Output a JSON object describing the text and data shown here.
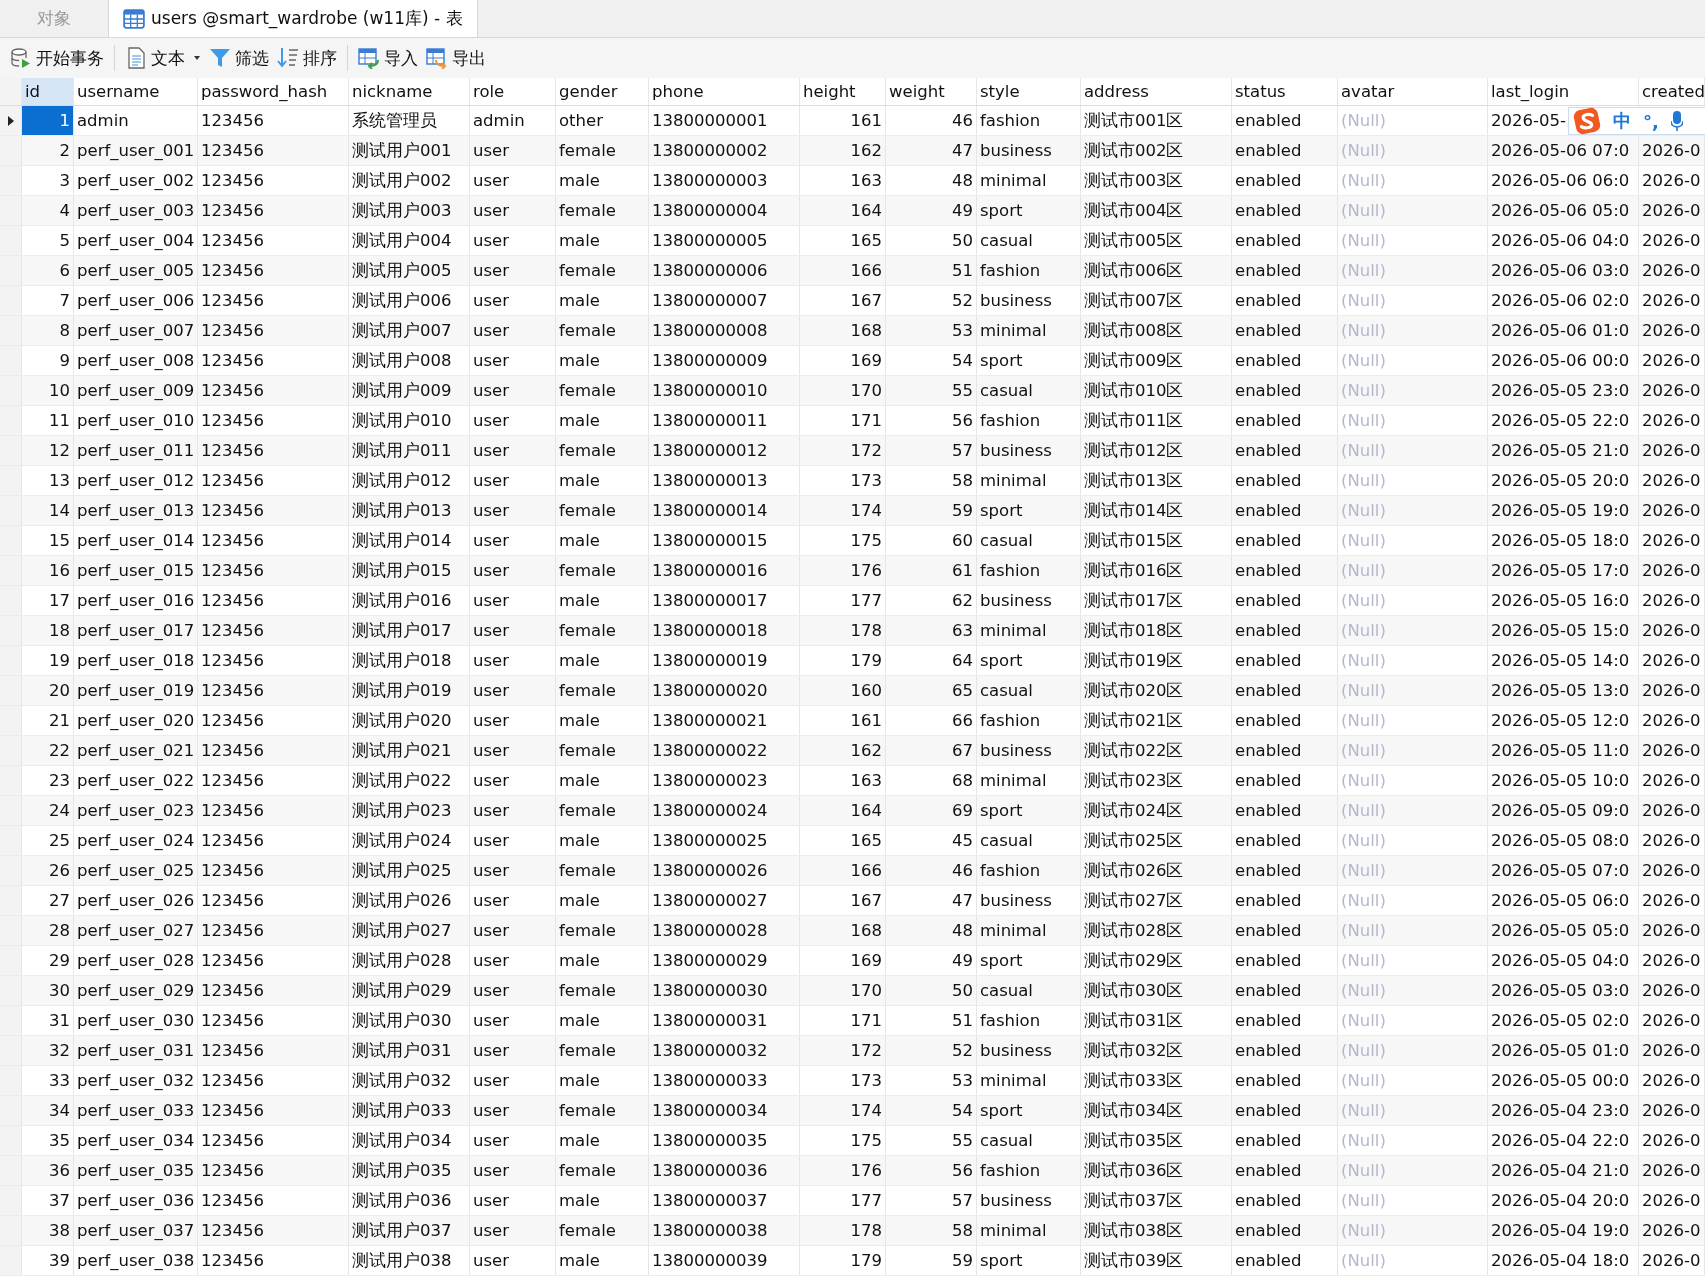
{
  "tabs": [
    {
      "label": "对象",
      "selected": false,
      "icon": false
    },
    {
      "label": "users @smart_wardrobe (w11库) - 表",
      "selected": true,
      "icon": true
    }
  ],
  "toolbar": [
    {
      "label": "开始事务",
      "kind": "transaction",
      "dropdown": false,
      "group_end": true
    },
    {
      "label": "文本",
      "kind": "text",
      "dropdown": true,
      "group_end": false
    },
    {
      "label": "筛选",
      "kind": "filter",
      "dropdown": false,
      "group_end": false
    },
    {
      "label": "排序",
      "kind": "sort",
      "dropdown": false,
      "group_end": true
    },
    {
      "label": "导入",
      "kind": "import",
      "dropdown": false,
      "group_end": false
    },
    {
      "label": "导出",
      "kind": "export",
      "dropdown": false,
      "group_end": false
    }
  ],
  "table": {
    "columns": [
      {
        "name": "id",
        "kind": "number"
      },
      {
        "name": "username",
        "kind": "text"
      },
      {
        "name": "password_hash",
        "kind": "text"
      },
      {
        "name": "nickname",
        "kind": "text"
      },
      {
        "name": "role",
        "kind": "text"
      },
      {
        "name": "gender",
        "kind": "text"
      },
      {
        "name": "phone",
        "kind": "text"
      },
      {
        "name": "height",
        "kind": "number"
      },
      {
        "name": "weight",
        "kind": "number"
      },
      {
        "name": "style",
        "kind": "text"
      },
      {
        "name": "address",
        "kind": "text"
      },
      {
        "name": "status",
        "kind": "text"
      },
      {
        "name": "avatar",
        "kind": "null"
      },
      {
        "name": "last_login",
        "kind": "text"
      },
      {
        "name": "created",
        "kind": "text"
      }
    ],
    "rows": [
      {
        "selected": true,
        "cells": [
          "1",
          "admin",
          "123456",
          "系统管理员",
          "admin",
          "other",
          "13800000001",
          "161",
          "46",
          "fashion",
          "测试市001区",
          "enabled",
          "(Null)",
          "2026-05-"
        ]
      },
      {
        "selected": false,
        "cells": [
          "2",
          "perf_user_001",
          "123456",
          "测试用户001",
          "user",
          "female",
          "13800000002",
          "162",
          "47",
          "business",
          "测试市002区",
          "enabled",
          "(Null)",
          "2026-05-06 07:0",
          "2026-0"
        ]
      },
      {
        "selected": false,
        "cells": [
          "3",
          "perf_user_002",
          "123456",
          "测试用户002",
          "user",
          "male",
          "13800000003",
          "163",
          "48",
          "minimal",
          "测试市003区",
          "enabled",
          "(Null)",
          "2026-05-06 06:0",
          "2026-0"
        ]
      },
      {
        "selected": false,
        "cells": [
          "4",
          "perf_user_003",
          "123456",
          "测试用户003",
          "user",
          "female",
          "13800000004",
          "164",
          "49",
          "sport",
          "测试市004区",
          "enabled",
          "(Null)",
          "2026-05-06 05:0",
          "2026-0"
        ]
      },
      {
        "selected": false,
        "cells": [
          "5",
          "perf_user_004",
          "123456",
          "测试用户004",
          "user",
          "male",
          "13800000005",
          "165",
          "50",
          "casual",
          "测试市005区",
          "enabled",
          "(Null)",
          "2026-05-06 04:0",
          "2026-0"
        ]
      },
      {
        "selected": false,
        "cells": [
          "6",
          "perf_user_005",
          "123456",
          "测试用户005",
          "user",
          "female",
          "13800000006",
          "166",
          "51",
          "fashion",
          "测试市006区",
          "enabled",
          "(Null)",
          "2026-05-06 03:0",
          "2026-0"
        ]
      },
      {
        "selected": false,
        "cells": [
          "7",
          "perf_user_006",
          "123456",
          "测试用户006",
          "user",
          "male",
          "13800000007",
          "167",
          "52",
          "business",
          "测试市007区",
          "enabled",
          "(Null)",
          "2026-05-06 02:0",
          "2026-0"
        ]
      },
      {
        "selected": false,
        "cells": [
          "8",
          "perf_user_007",
          "123456",
          "测试用户007",
          "user",
          "female",
          "13800000008",
          "168",
          "53",
          "minimal",
          "测试市008区",
          "enabled",
          "(Null)",
          "2026-05-06 01:0",
          "2026-0"
        ]
      },
      {
        "selected": false,
        "cells": [
          "9",
          "perf_user_008",
          "123456",
          "测试用户008",
          "user",
          "male",
          "13800000009",
          "169",
          "54",
          "sport",
          "测试市009区",
          "enabled",
          "(Null)",
          "2026-05-06 00:0",
          "2026-0"
        ]
      },
      {
        "selected": false,
        "cells": [
          "10",
          "perf_user_009",
          "123456",
          "测试用户009",
          "user",
          "female",
          "13800000010",
          "170",
          "55",
          "casual",
          "测试市010区",
          "enabled",
          "(Null)",
          "2026-05-05 23:0",
          "2026-0"
        ]
      },
      {
        "selected": false,
        "cells": [
          "11",
          "perf_user_010",
          "123456",
          "测试用户010",
          "user",
          "male",
          "13800000011",
          "171",
          "56",
          "fashion",
          "测试市011区",
          "enabled",
          "(Null)",
          "2026-05-05 22:0",
          "2026-0"
        ]
      },
      {
        "selected": false,
        "cells": [
          "12",
          "perf_user_011",
          "123456",
          "测试用户011",
          "user",
          "female",
          "13800000012",
          "172",
          "57",
          "business",
          "测试市012区",
          "enabled",
          "(Null)",
          "2026-05-05 21:0",
          "2026-0"
        ]
      },
      {
        "selected": false,
        "cells": [
          "13",
          "perf_user_012",
          "123456",
          "测试用户012",
          "user",
          "male",
          "13800000013",
          "173",
          "58",
          "minimal",
          "测试市013区",
          "enabled",
          "(Null)",
          "2026-05-05 20:0",
          "2026-0"
        ]
      },
      {
        "selected": false,
        "cells": [
          "14",
          "perf_user_013",
          "123456",
          "测试用户013",
          "user",
          "female",
          "13800000014",
          "174",
          "59",
          "sport",
          "测试市014区",
          "enabled",
          "(Null)",
          "2026-05-05 19:0",
          "2026-0"
        ]
      },
      {
        "selected": false,
        "cells": [
          "15",
          "perf_user_014",
          "123456",
          "测试用户014",
          "user",
          "male",
          "13800000015",
          "175",
          "60",
          "casual",
          "测试市015区",
          "enabled",
          "(Null)",
          "2026-05-05 18:0",
          "2026-0"
        ]
      },
      {
        "selected": false,
        "cells": [
          "16",
          "perf_user_015",
          "123456",
          "测试用户015",
          "user",
          "female",
          "13800000016",
          "176",
          "61",
          "fashion",
          "测试市016区",
          "enabled",
          "(Null)",
          "2026-05-05 17:0",
          "2026-0"
        ]
      },
      {
        "selected": false,
        "cells": [
          "17",
          "perf_user_016",
          "123456",
          "测试用户016",
          "user",
          "male",
          "13800000017",
          "177",
          "62",
          "business",
          "测试市017区",
          "enabled",
          "(Null)",
          "2026-05-05 16:0",
          "2026-0"
        ]
      },
      {
        "selected": false,
        "cells": [
          "18",
          "perf_user_017",
          "123456",
          "测试用户017",
          "user",
          "female",
          "13800000018",
          "178",
          "63",
          "minimal",
          "测试市018区",
          "enabled",
          "(Null)",
          "2026-05-05 15:0",
          "2026-0"
        ]
      },
      {
        "selected": false,
        "cells": [
          "19",
          "perf_user_018",
          "123456",
          "测试用户018",
          "user",
          "male",
          "13800000019",
          "179",
          "64",
          "sport",
          "测试市019区",
          "enabled",
          "(Null)",
          "2026-05-05 14:0",
          "2026-0"
        ]
      },
      {
        "selected": false,
        "cells": [
          "20",
          "perf_user_019",
          "123456",
          "测试用户019",
          "user",
          "female",
          "13800000020",
          "160",
          "65",
          "casual",
          "测试市020区",
          "enabled",
          "(Null)",
          "2026-05-05 13:0",
          "2026-0"
        ]
      },
      {
        "selected": false,
        "cells": [
          "21",
          "perf_user_020",
          "123456",
          "测试用户020",
          "user",
          "male",
          "13800000021",
          "161",
          "66",
          "fashion",
          "测试市021区",
          "enabled",
          "(Null)",
          "2026-05-05 12:0",
          "2026-0"
        ]
      },
      {
        "selected": false,
        "cells": [
          "22",
          "perf_user_021",
          "123456",
          "测试用户021",
          "user",
          "female",
          "13800000022",
          "162",
          "67",
          "business",
          "测试市022区",
          "enabled",
          "(Null)",
          "2026-05-05 11:0",
          "2026-0"
        ]
      },
      {
        "selected": false,
        "cells": [
          "23",
          "perf_user_022",
          "123456",
          "测试用户022",
          "user",
          "male",
          "13800000023",
          "163",
          "68",
          "minimal",
          "测试市023区",
          "enabled",
          "(Null)",
          "2026-05-05 10:0",
          "2026-0"
        ]
      },
      {
        "selected": false,
        "cells": [
          "24",
          "perf_user_023",
          "123456",
          "测试用户023",
          "user",
          "female",
          "13800000024",
          "164",
          "69",
          "sport",
          "测试市024区",
          "enabled",
          "(Null)",
          "2026-05-05 09:0",
          "2026-0"
        ]
      },
      {
        "selected": false,
        "cells": [
          "25",
          "perf_user_024",
          "123456",
          "测试用户024",
          "user",
          "male",
          "13800000025",
          "165",
          "45",
          "casual",
          "测试市025区",
          "enabled",
          "(Null)",
          "2026-05-05 08:0",
          "2026-0"
        ]
      },
      {
        "selected": false,
        "cells": [
          "26",
          "perf_user_025",
          "123456",
          "测试用户025",
          "user",
          "female",
          "13800000026",
          "166",
          "46",
          "fashion",
          "测试市026区",
          "enabled",
          "(Null)",
          "2026-05-05 07:0",
          "2026-0"
        ]
      },
      {
        "selected": false,
        "cells": [
          "27",
          "perf_user_026",
          "123456",
          "测试用户026",
          "user",
          "male",
          "13800000027",
          "167",
          "47",
          "business",
          "测试市027区",
          "enabled",
          "(Null)",
          "2026-05-05 06:0",
          "2026-0"
        ]
      },
      {
        "selected": false,
        "cells": [
          "28",
          "perf_user_027",
          "123456",
          "测试用户027",
          "user",
          "female",
          "13800000028",
          "168",
          "48",
          "minimal",
          "测试市028区",
          "enabled",
          "(Null)",
          "2026-05-05 05:0",
          "2026-0"
        ]
      },
      {
        "selected": false,
        "cells": [
          "29",
          "perf_user_028",
          "123456",
          "测试用户028",
          "user",
          "male",
          "13800000029",
          "169",
          "49",
          "sport",
          "测试市029区",
          "enabled",
          "(Null)",
          "2026-05-05 04:0",
          "2026-0"
        ]
      },
      {
        "selected": false,
        "cells": [
          "30",
          "perf_user_029",
          "123456",
          "测试用户029",
          "user",
          "female",
          "13800000030",
          "170",
          "50",
          "casual",
          "测试市030区",
          "enabled",
          "(Null)",
          "2026-05-05 03:0",
          "2026-0"
        ]
      },
      {
        "selected": false,
        "cells": [
          "31",
          "perf_user_030",
          "123456",
          "测试用户030",
          "user",
          "male",
          "13800000031",
          "171",
          "51",
          "fashion",
          "测试市031区",
          "enabled",
          "(Null)",
          "2026-05-05 02:0",
          "2026-0"
        ]
      },
      {
        "selected": false,
        "cells": [
          "32",
          "perf_user_031",
          "123456",
          "测试用户031",
          "user",
          "female",
          "13800000032",
          "172",
          "52",
          "business",
          "测试市032区",
          "enabled",
          "(Null)",
          "2026-05-05 01:0",
          "2026-0"
        ]
      },
      {
        "selected": false,
        "cells": [
          "33",
          "perf_user_032",
          "123456",
          "测试用户032",
          "user",
          "male",
          "13800000033",
          "173",
          "53",
          "minimal",
          "测试市033区",
          "enabled",
          "(Null)",
          "2026-05-05 00:0",
          "2026-0"
        ]
      },
      {
        "selected": false,
        "cells": [
          "34",
          "perf_user_033",
          "123456",
          "测试用户033",
          "user",
          "female",
          "13800000034",
          "174",
          "54",
          "sport",
          "测试市034区",
          "enabled",
          "(Null)",
          "2026-05-04 23:0",
          "2026-0"
        ]
      },
      {
        "selected": false,
        "cells": [
          "35",
          "perf_user_034",
          "123456",
          "测试用户034",
          "user",
          "male",
          "13800000035",
          "175",
          "55",
          "casual",
          "测试市035区",
          "enabled",
          "(Null)",
          "2026-05-04 22:0",
          "2026-0"
        ]
      },
      {
        "selected": false,
        "cells": [
          "36",
          "perf_user_035",
          "123456",
          "测试用户035",
          "user",
          "female",
          "13800000036",
          "176",
          "56",
          "fashion",
          "测试市036区",
          "enabled",
          "(Null)",
          "2026-05-04 21:0",
          "2026-0"
        ]
      },
      {
        "selected": false,
        "cells": [
          "37",
          "perf_user_036",
          "123456",
          "测试用户036",
          "user",
          "male",
          "13800000037",
          "177",
          "57",
          "business",
          "测试市037区",
          "enabled",
          "(Null)",
          "2026-05-04 20:0",
          "2026-0"
        ]
      },
      {
        "selected": false,
        "cells": [
          "38",
          "perf_user_037",
          "123456",
          "测试用户037",
          "user",
          "female",
          "13800000038",
          "178",
          "58",
          "minimal",
          "测试市038区",
          "enabled",
          "(Null)",
          "2026-05-04 19:0",
          "2026-0"
        ]
      },
      {
        "selected": false,
        "cells": [
          "39",
          "perf_user_038",
          "123456",
          "测试用户038",
          "user",
          "male",
          "13800000039",
          "179",
          "59",
          "sport",
          "测试市039区",
          "enabled",
          "(Null)",
          "2026-05-04 18:0",
          "2026-0"
        ]
      }
    ]
  },
  "ime_bar": {
    "mode": "中",
    "punctuation": "°,"
  }
}
